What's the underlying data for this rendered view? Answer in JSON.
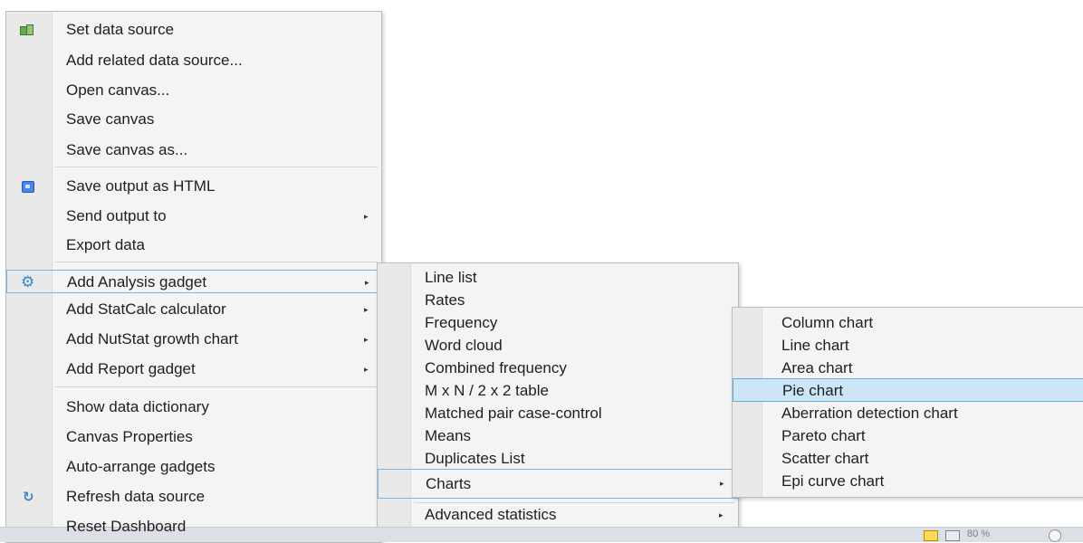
{
  "main_menu": {
    "items": [
      {
        "label": "Set data source",
        "icon": "data-source-icon"
      },
      {
        "label": "Add related data source..."
      },
      {
        "label": "Open canvas..."
      },
      {
        "label": "Save canvas"
      },
      {
        "label": "Save canvas as..."
      },
      {
        "label": "Save output as HTML",
        "icon": "html-icon"
      },
      {
        "label": "Send output to",
        "submenu": true
      },
      {
        "label": "Export data"
      },
      {
        "label": "Add Analysis gadget",
        "icon": "gear-icon",
        "submenu": true,
        "highlighted": true
      },
      {
        "label": "Add StatCalc calculator",
        "submenu": true
      },
      {
        "label": "Add NutStat growth chart",
        "submenu": true
      },
      {
        "label": "Add Report gadget",
        "submenu": true
      },
      {
        "label": "Show data dictionary"
      },
      {
        "label": "Canvas Properties"
      },
      {
        "label": "Auto-arrange gadgets"
      },
      {
        "label": "Refresh data source",
        "icon": "refresh-icon"
      },
      {
        "label": "Reset Dashboard"
      }
    ]
  },
  "analysis_submenu": {
    "items": [
      {
        "label": "Line list"
      },
      {
        "label": "Rates"
      },
      {
        "label": "Frequency"
      },
      {
        "label": "Word cloud"
      },
      {
        "label": "Combined frequency"
      },
      {
        "label": "M x N / 2 x 2 table"
      },
      {
        "label": "Matched pair case-control"
      },
      {
        "label": "Means"
      },
      {
        "label": "Duplicates List"
      },
      {
        "label": "Charts",
        "submenu": true,
        "highlighted": true
      },
      {
        "label": "Advanced statistics",
        "submenu": true
      }
    ]
  },
  "charts_submenu": {
    "items": [
      {
        "label": "Column chart"
      },
      {
        "label": "Line chart"
      },
      {
        "label": "Area chart"
      },
      {
        "label": "Pie chart",
        "selected": true
      },
      {
        "label": "Aberration detection chart"
      },
      {
        "label": "Pareto chart"
      },
      {
        "label": "Scatter chart"
      },
      {
        "label": "Epi curve chart"
      }
    ]
  },
  "status_bar": {
    "zoom_label": "80 %"
  },
  "colors": {
    "menu_background": "#f4f4f4",
    "highlight_border": "#7fb3da",
    "selected_background": "#cde6f7",
    "icon_blue": "#3d85c6"
  }
}
